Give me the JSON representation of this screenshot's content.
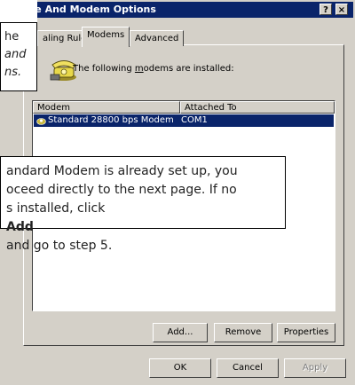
{
  "window": {
    "title": "Phone And Modem Options",
    "help_label": "?",
    "close_label": "×"
  },
  "tabs": [
    {
      "label": "aling Rules"
    },
    {
      "label": "Modems"
    },
    {
      "label": "Advanced"
    }
  ],
  "panel": {
    "installed_prefix": "The following ",
    "installed_key": "m",
    "installed_suffix": "odems are installed:",
    "columns": [
      "Modem",
      "Attached To"
    ],
    "rows": [
      {
        "modem": "Standard 28800 bps Modem",
        "attached": "COM1"
      }
    ]
  },
  "buttons": {
    "add": "Add...",
    "remove": "Remove",
    "properties": "Properties",
    "ok": "OK",
    "cancel": "Cancel",
    "apply": "Apply"
  },
  "callouts": {
    "top": {
      "line1": "he",
      "line2": "and",
      "line3": "ns."
    },
    "middle": {
      "line1": "andard Modem is already set up, you",
      "line2": "oceed directly to the next page. If no",
      "line3_pre": "s installed, click ",
      "line3_bold": "Add",
      "line3_post": " and go to step 5."
    }
  },
  "colors": {
    "titlebar": "#0a246a",
    "dialog_face": "#d4d0c8",
    "selection": "#0a246a"
  }
}
